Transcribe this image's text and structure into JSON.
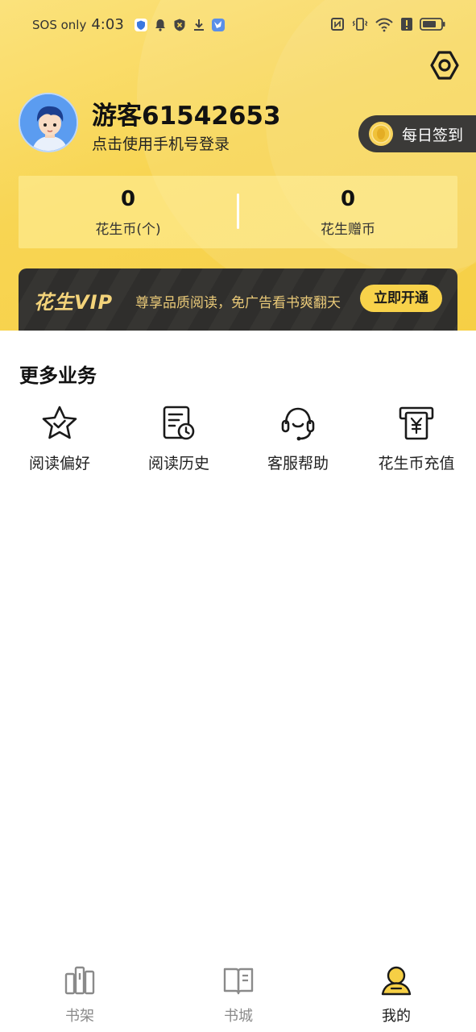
{
  "status_bar": {
    "sos": "SOS only",
    "time": "4:03"
  },
  "profile": {
    "username": "游客61542653",
    "login_hint": "点击使用手机号登录",
    "checkin_label": "每日签到"
  },
  "balance": {
    "coins_value": "0",
    "coins_label": "花生币(个)",
    "gift_value": "0",
    "gift_label": "花生赠币"
  },
  "vip": {
    "logo": "花生VIP",
    "description": "尊享品质阅读，免广告看书爽翻天",
    "button_label": "立即开通"
  },
  "more_services": {
    "title": "更多业务",
    "items": [
      {
        "label": "阅读偏好",
        "icon": "star-check-icon"
      },
      {
        "label": "阅读历史",
        "icon": "history-doc-icon"
      },
      {
        "label": "客服帮助",
        "icon": "headset-icon"
      },
      {
        "label": "花生币充值",
        "icon": "yuan-recharge-icon"
      }
    ]
  },
  "bottom_nav": {
    "items": [
      {
        "label": "书架",
        "icon": "bookshelf-icon",
        "active": false
      },
      {
        "label": "书城",
        "icon": "open-book-icon",
        "active": false
      },
      {
        "label": "我的",
        "icon": "user-icon",
        "active": true
      }
    ]
  },
  "colors": {
    "header_yellow": "#f8d553",
    "vip_dark": "#2f2e2c",
    "vip_gold": "#e9c978",
    "vip_button": "#f8d24a",
    "nav_active": "#1a1a1a",
    "nav_inactive": "#8a8a8a"
  }
}
